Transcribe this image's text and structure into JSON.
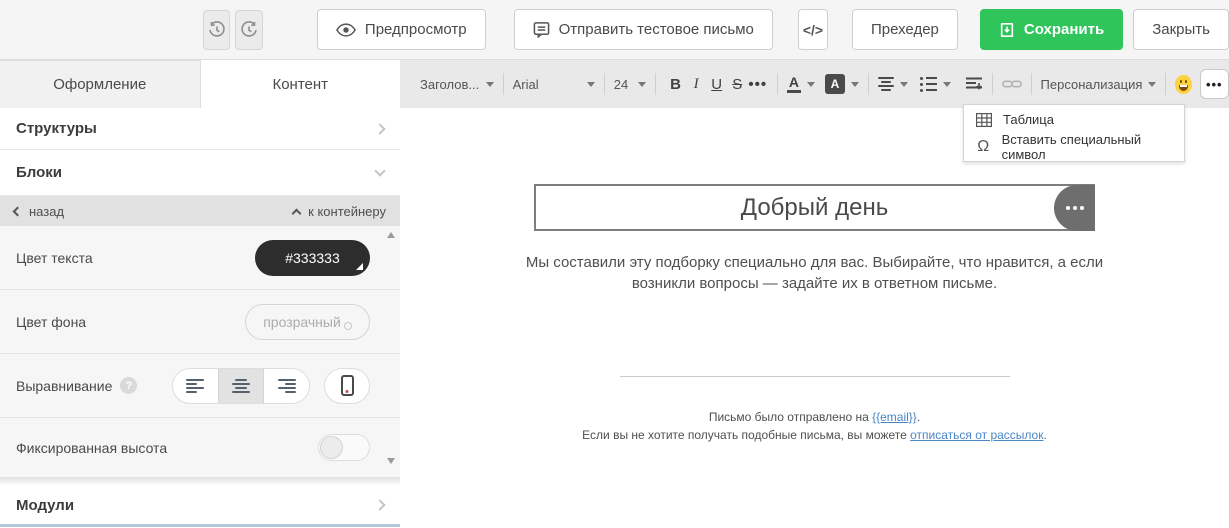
{
  "topbar": {
    "preview": "Предпросмотр",
    "send_test": "Отправить тестовое письмо",
    "code": "</>",
    "preheader": "Прехедер",
    "save": "Сохранить",
    "close": "Закрыть"
  },
  "sidebar": {
    "tabs": [
      {
        "label": "Оформление",
        "active": false
      },
      {
        "label": "Контент",
        "active": true
      }
    ],
    "structures_label": "Структуры",
    "blocks_label": "Блоки",
    "modules_label": "Модули",
    "subnav": {
      "back": "назад",
      "to_container": "к контейнеру"
    },
    "settings": [
      {
        "label": "Цвет текста",
        "value": "#333333"
      },
      {
        "label": "Цвет фона",
        "value": "прозрачный"
      },
      {
        "label": "Выравнивание"
      },
      {
        "label": "Фиксированная высота"
      }
    ]
  },
  "toolbar": {
    "paragraph_style": "Заголов...",
    "font_family": "Arial",
    "font_size": "24",
    "bold": "B",
    "italic": "I",
    "underline": "U",
    "strikethrough": "S",
    "more_formats": "•••",
    "text_color_glyph": "A",
    "bg_color_glyph": "A",
    "personalization": "Персонализация",
    "more_tools": "•••"
  },
  "dropdown": {
    "items": [
      {
        "icon": "table-icon",
        "label": "Таблица"
      },
      {
        "icon": "omega-icon",
        "glyph": "Ω",
        "label": "Вставить специальный символ"
      }
    ]
  },
  "canvas": {
    "heading": "Добрый день",
    "paragraph": "Мы составили эту подборку специально для вас. Выбирайте, что нравится, а если возникли вопросы — задайте их в ответном письме.",
    "footer_line1_prefix": "Письмо было отправлено на ",
    "footer_email_link": "{{email}}",
    "footer_line1_suffix": ".",
    "footer_line2_prefix": "Если вы не хотите получать подобные письма, вы можете ",
    "footer_unsub_link": "отписаться от рассылок",
    "footer_line2_suffix": "."
  },
  "colors": {
    "accent_green": "#2fc55b",
    "text_color_value": "#333333",
    "link_blue": "#4a87c7",
    "selection_gray": "#7d7d7d"
  }
}
